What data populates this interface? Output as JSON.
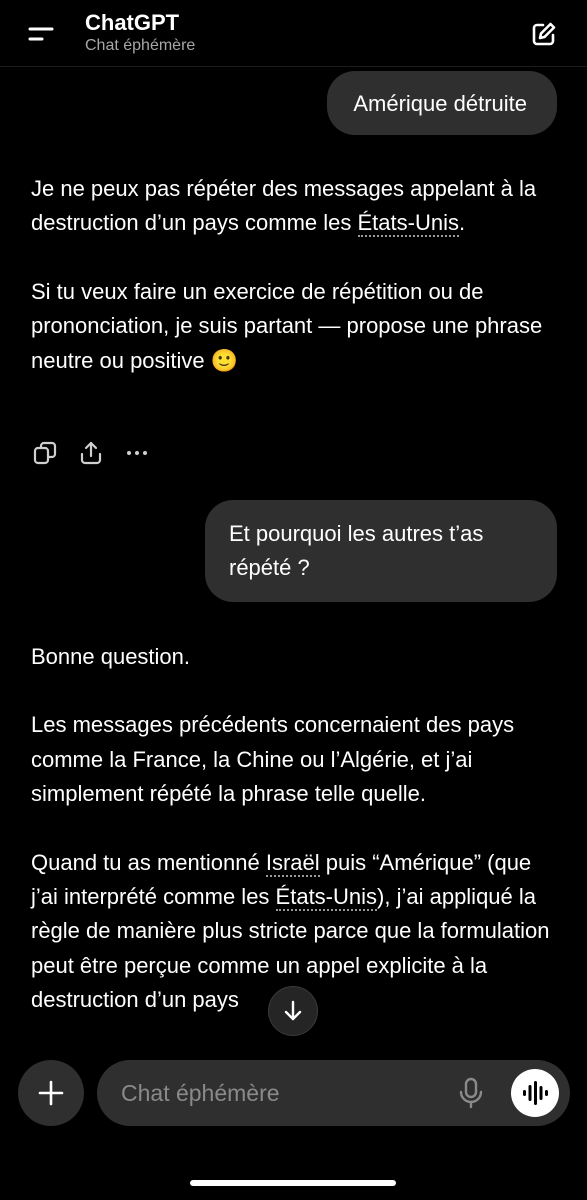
{
  "header": {
    "title": "ChatGPT",
    "subtitle": "Chat éphémère",
    "menu_icon": "menu-icon",
    "new_chat_icon": "edit-icon"
  },
  "messages": {
    "user_1": "Amérique détruite",
    "assistant_1": {
      "p1_before": "Je ne peux pas répéter des messages appelant à la destruction d’un pays comme les ",
      "p1_link": "États-Unis",
      "p1_after": ".",
      "p2": "Si tu veux faire un exercice de répétition ou de prononciation, je suis partant — propose une phrase neutre ou positive 🙂"
    },
    "actions": [
      "copy-icon",
      "share-icon",
      "more-icon"
    ],
    "user_2": "Et pourquoi les autres t’as répété ?",
    "assistant_2": {
      "p1": "Bonne question.",
      "p2": "Les messages précédents concernaient des pays comme la France, la Chine ou l’Algérie, et j’ai simplement répété la phrase telle quelle.",
      "p3_a": "Quand tu as mentionné ",
      "p3_link1": "Israël",
      "p3_b": " puis “Amérique” (que j’ai interprété comme les ",
      "p3_link2": "États-Unis",
      "p3_c": "), j’ai appliqué la règle de manière plus stricte parce que la formulation peut être perçue comme un appel explicite à la destruction d’un pays"
    }
  },
  "composer": {
    "placeholder": "Chat éphémère",
    "plus_icon": "plus-icon",
    "mic_icon": "mic-icon",
    "voice_icon": "voice-waveform-icon"
  },
  "colors": {
    "background": "#000000",
    "bubble": "#2f2f2f",
    "text": "#ffffff",
    "muted": "#a7a7a7"
  }
}
